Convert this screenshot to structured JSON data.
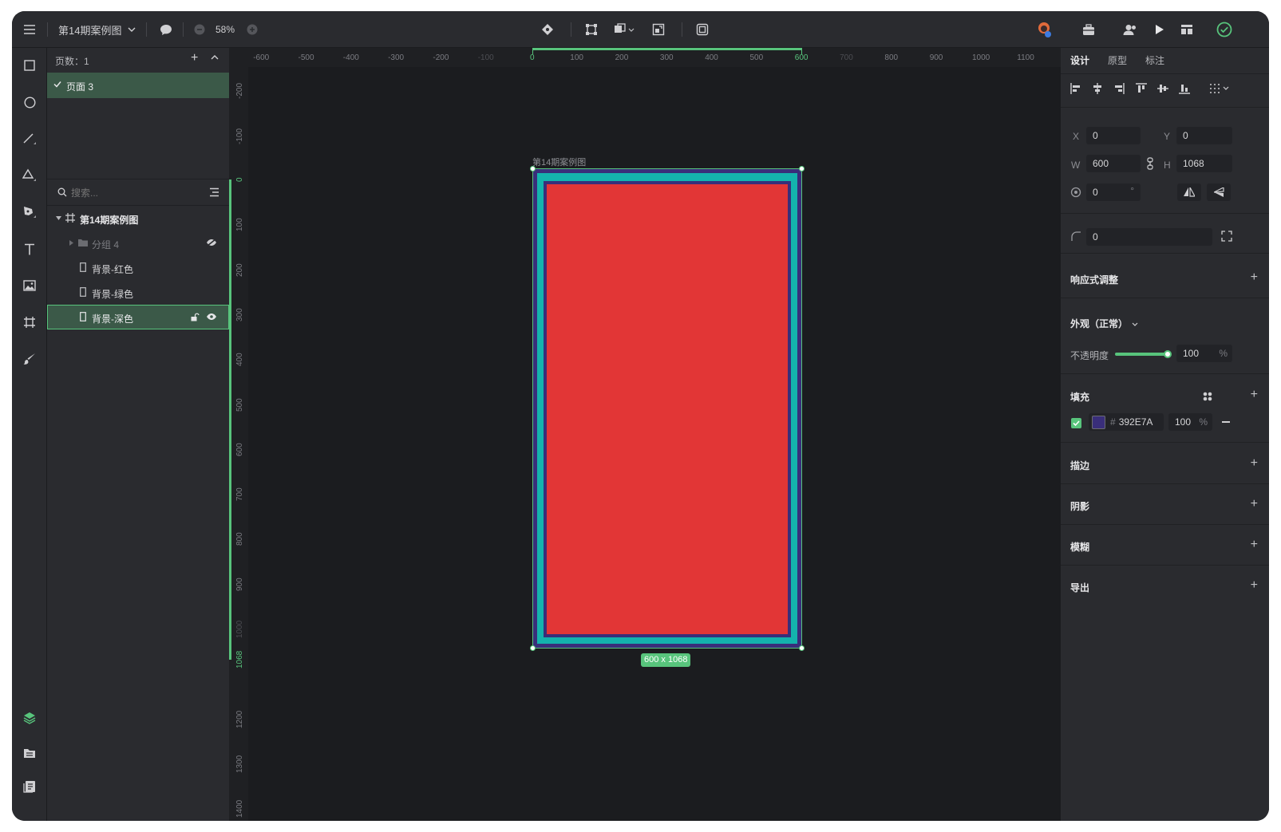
{
  "topbar": {
    "doc_title": "第14期案例图",
    "zoom": "58%"
  },
  "layers_panel": {
    "pages_label": "页数：1",
    "pages": [
      {
        "label": "页面 3",
        "selected": true
      }
    ],
    "search_placeholder": "搜索...",
    "layers": [
      {
        "label": "第14期案例图",
        "type": "artboard",
        "bold": true
      },
      {
        "label": "分组 4",
        "type": "group",
        "hidden": true
      },
      {
        "label": "背景-红色",
        "type": "rect"
      },
      {
        "label": "背景-绿色",
        "type": "rect"
      },
      {
        "label": "背景-深色",
        "type": "rect",
        "selected": true
      }
    ]
  },
  "rulers": {
    "horizontal": [
      "-600",
      "-500",
      "-400",
      "-300",
      "-200",
      "-100",
      "0",
      "100",
      "200",
      "300",
      "400",
      "500",
      "600",
      "700",
      "800",
      "900",
      "1000",
      "1100"
    ],
    "vertical": [
      "-200",
      "-100",
      "0",
      "100",
      "200",
      "300",
      "400",
      "500",
      "600",
      "700",
      "800",
      "900",
      "1000",
      "1068",
      "1200",
      "1300",
      "1400"
    ]
  },
  "canvas": {
    "artboard_label": "第14期案例图",
    "size_badge": "600 x 1068",
    "colors": {
      "outer": "#392E7A",
      "middle": "#14B3AD",
      "inner_border": "#392E7A",
      "fill": "#E23636",
      "selection": "#58C47C"
    }
  },
  "right_panel": {
    "tabs": [
      "设计",
      "原型",
      "标注"
    ],
    "active_tab": "设计",
    "x_label": "X",
    "x_value": "0",
    "y_label": "Y",
    "y_value": "0",
    "w_label": "W",
    "w_value": "600",
    "h_label": "H",
    "h_value": "1068",
    "rotation_value": "0",
    "rotation_unit": "°",
    "radius_value": "0",
    "responsive_title": "响应式调整",
    "appearance_title": "外观（正常）",
    "opacity_label": "不透明度",
    "opacity_value": "100",
    "opacity_unit": "%",
    "opacity_level": 1.0,
    "fill_title": "填充",
    "fill_hash": "#",
    "fill_hex": "392E7A",
    "fill_color": "#392E7A",
    "fill_opacity": "100",
    "fill_opacity_unit": "%",
    "stroke_title": "描边",
    "shadow_title": "阴影",
    "blur_title": "模糊",
    "export_title": "导出"
  },
  "accent_color": "#58C47C"
}
